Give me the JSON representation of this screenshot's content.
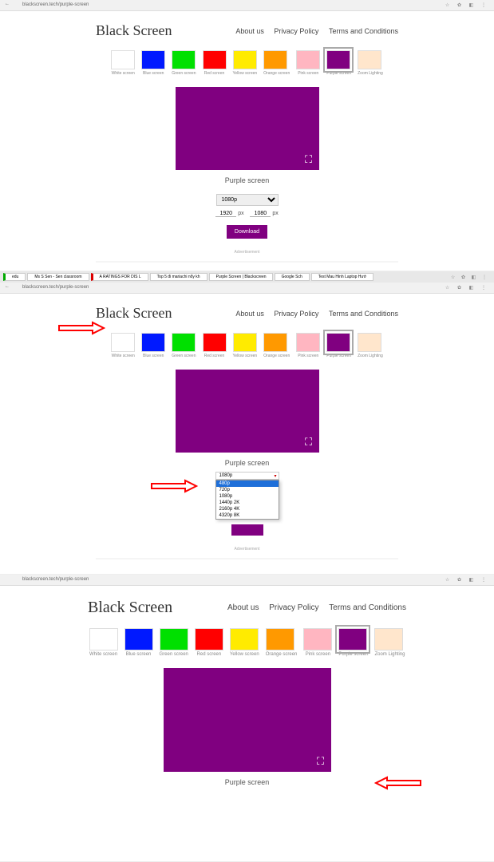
{
  "browser": {
    "url_short": "blackscreen.tech/purple-screen",
    "url_full": "blackscreen.tech/purple-screen",
    "toolbar_icons": "☆ ✿ ◧ ⋮",
    "tabs": [
      {
        "label": "edu"
      },
      {
        "label": "Ms S Sen - Sen classroom"
      },
      {
        "label": "A RATINGS FOR DIS L"
      },
      {
        "label": "Top 5 đi mariachi nổy kh"
      },
      {
        "label": "Purple Screen | Blackscreen"
      },
      {
        "label": "Google Sch"
      },
      {
        "label": "Test Mau Hinh Laptop Hướ"
      }
    ]
  },
  "site": {
    "logo": "Black Screen",
    "nav": {
      "about": "About us",
      "privacy": "Privacy Policy",
      "terms": "Terms and Conditions"
    }
  },
  "swatches": [
    {
      "name": "white",
      "label": "White screen",
      "color": "#ffffff"
    },
    {
      "name": "blue",
      "label": "Blue screen",
      "color": "#0019ff"
    },
    {
      "name": "green",
      "label": "Green screen",
      "color": "#00e000"
    },
    {
      "name": "red",
      "label": "Red screen",
      "color": "#ff0000"
    },
    {
      "name": "yellow",
      "label": "Yellow screen",
      "color": "#ffeb00"
    },
    {
      "name": "orange",
      "label": "Orange screen",
      "color": "#ff9900"
    },
    {
      "name": "pink",
      "label": "Pink screen",
      "color": "#ffb6c1"
    },
    {
      "name": "purple",
      "label": "Purple screen",
      "color": "#800080"
    },
    {
      "name": "zoom",
      "label": "Zoom Lighting",
      "color": "#ffe6cc"
    }
  ],
  "preview": {
    "caption": "Purple screen",
    "resolution_selected": "1080p",
    "width": "1920",
    "height": "1080",
    "px": "px",
    "download": "Download"
  },
  "dropdown": {
    "options": [
      "1080p",
      "480p",
      "720p",
      "1080p",
      "1440p 2K",
      "2160p 4K",
      "4320p 8K"
    ]
  },
  "ad": "Advertisement"
}
